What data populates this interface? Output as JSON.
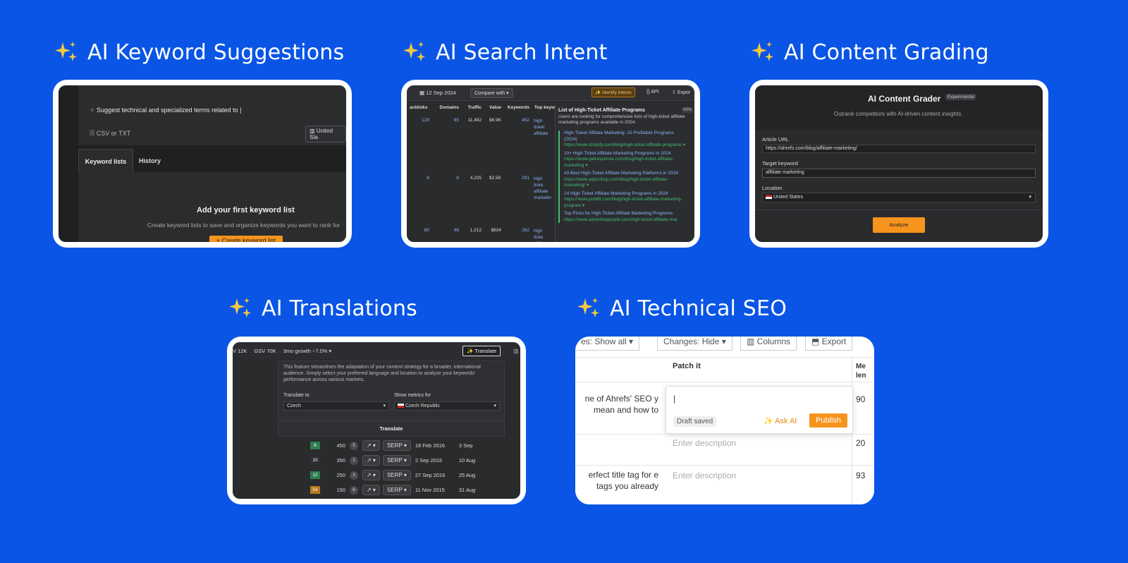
{
  "features": [
    {
      "title": "AI Keyword Suggestions"
    },
    {
      "title": "AI Search Intent"
    },
    {
      "title": "AI Content Grading"
    },
    {
      "title": "AI Translations"
    },
    {
      "title": "AI Technical SEO"
    }
  ],
  "keyword": {
    "prompt": "Suggest technical and specialized terms related to |",
    "file_hint": "CSV or TXT",
    "country": "United Sta",
    "tab_lists": "Keyword lists",
    "tab_history": "History",
    "empty_title": "Add your first keyword list",
    "empty_desc": "Create keyword lists to save and organize keywords you want to rank for",
    "create_btn": "+ Create keyword list"
  },
  "intent": {
    "date": "12 Sep 2024",
    "compare": "Compare with",
    "identify_btn": "Identify intents",
    "api": "API",
    "export": "Expor",
    "columns": [
      "acklinks",
      "Domains",
      "Traffic",
      "Value",
      "Keywords",
      "Top keyw"
    ],
    "rows": [
      {
        "backlinks": "129",
        "domains": "65",
        "traffic": "11,492",
        "value": "$6.9K",
        "keywords": "452",
        "top": "high ticket affiliate"
      },
      {
        "backlinks": "8",
        "domains": "8",
        "traffic": "4,205",
        "value": "$2.5K",
        "keywords": "291",
        "top": "high ticke affiliate marketin"
      },
      {
        "backlinks": "80",
        "domains": "46",
        "traffic": "1,212",
        "value": "$634",
        "keywords": "262",
        "top": "high ticke affiliate"
      }
    ],
    "popup_title": "List of High-Ticket Affiliate Programs",
    "popup_desc": "Users are looking for comprehensive lists of high-ticket affiliate marketing programs available in 2024.",
    "popup_badge": "43%",
    "results": [
      {
        "title": "High-Ticket Affiliate Marketing: 15 Profitable Programs (2024)",
        "url": "https://www.shopify.com/blog/high-ticket-affiliate-programs ▾"
      },
      {
        "title": "10+ High-Ticket Affiliate Marketing Programs in 2024",
        "url": "https://www.getresponse.com/blog/high-ticket-affiliate-marketing ▾"
      },
      {
        "title": "43 Best High-Ticket Affiliate Marketing Platforms in 2024",
        "url": "https://www.adpushup.com/blog/high-ticket-affiliate-marketing/ ▾"
      },
      {
        "title": "14 High-Ticket Affiliate Marketing Programs in 2024",
        "url": "https://www.publift.com/blog/high-ticket-affiliate-marketing-program ▾"
      },
      {
        "title": "Top Picks for High Ticket Affiliate Marketing Programs",
        "url": "https://www.advertisepurple.com/high-ticket-affiliate-mar"
      }
    ]
  },
  "grader": {
    "title": "AI Content Grader",
    "badge": "Experimental",
    "subtitle": "Outrank competitors with AI-driven content insights.",
    "url_label": "Article URL",
    "url_value": "https://ahrefs.com/blog/affiliate-marketing/",
    "kw_label": "Target keyword",
    "kw_value": "affiliate marketing",
    "loc_label": "Location",
    "loc_value": "United States",
    "analyze": "Analyze"
  },
  "translations": {
    "stats": [
      "V 12K",
      "GSV 70K",
      "3mo growth ~7.0% ▾"
    ],
    "translate_btn": "Translate",
    "desc": "This feature streamlines the adaptation of your content strategy for a broader, international audience. Simply select your preferred language and location to analyze your keywords' performance across various markets.",
    "to_label": "Translate to",
    "to_value": "Czech",
    "metrics_label": "Show metrics for",
    "metrics_value": "Czech Republic",
    "action": "Translate",
    "rows": [
      {
        "kd": "8",
        "kd_color": "#2e7d4f",
        "vol": "450",
        "n": "5",
        "serp": "SERP",
        "first": "18 Feb 2016",
        "last": "3 Sep"
      },
      {
        "kd": "10",
        "kd_color": "#2f3033",
        "vol": "350",
        "n": "1",
        "serp": "SERP",
        "first": "2 Sep 2015",
        "last": "10 Aug"
      },
      {
        "kd": "12",
        "kd_color": "#2e7d4f",
        "vol": "250",
        "n": "3",
        "serp": "SERP",
        "first": "27 Sep 2016",
        "last": "25 Aug"
      },
      {
        "kd": "54",
        "kd_color": "#b7791f",
        "vol": "150",
        "n": "6",
        "serp": "SERP",
        "first": "11 Nov 2015",
        "last": "31 Aug"
      }
    ]
  },
  "techseo": {
    "filter1": "es: Show all ▾",
    "filter2": "Changes: Hide ▾",
    "columns_btn": "Columns",
    "export_btn": "Export",
    "col_patch": "Patch it",
    "col_meta": "Me len",
    "row1_left": "ne of Ahrefs' SEO y mean and how to",
    "row1_num": "90",
    "draft": "Draft saved",
    "ask_ai": "Ask AI",
    "publish": "Publish",
    "row2_placeholder": "Enter description",
    "row2_num": "20",
    "row3_left": "erfect title tag for e tags you already",
    "row3_placeholder": "Enter description",
    "row3_num": "93"
  },
  "colors": {
    "background": "#0a55e6",
    "accent": "#f7941d",
    "spark": "#f5c842"
  }
}
